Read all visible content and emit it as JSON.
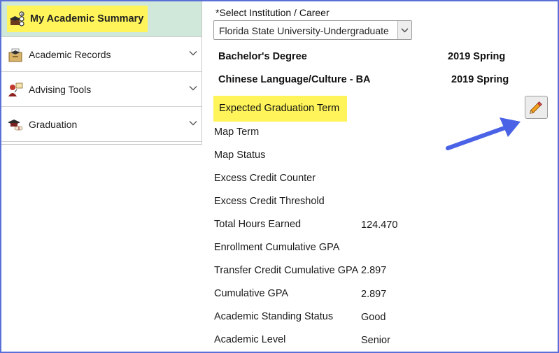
{
  "sidebar": {
    "items": [
      {
        "label": "My Academic Summary",
        "icon": "academic-summary-icon",
        "active": true,
        "expandable": false
      },
      {
        "label": "Academic Records",
        "icon": "academic-records-icon",
        "active": false,
        "expandable": true
      },
      {
        "label": "Advising Tools",
        "icon": "advising-tools-icon",
        "active": false,
        "expandable": true
      },
      {
        "label": "Graduation",
        "icon": "graduation-icon",
        "active": false,
        "expandable": true
      }
    ]
  },
  "main": {
    "select_label": "*Select Institution / Career",
    "select_value": "Florida State University-Undergraduate",
    "degrees": [
      {
        "name": "Bachelor's Degree",
        "term": "2019 Spring"
      },
      {
        "name": "Chinese Language/Culture - BA",
        "term": "2019 Spring"
      }
    ],
    "expected_graduation_label": "Expected Graduation Term",
    "rows": [
      {
        "label": "Map Term",
        "value": ""
      },
      {
        "label": "Map Status",
        "value": ""
      },
      {
        "label": "Excess Credit Counter",
        "value": ""
      },
      {
        "label": "Excess Credit Threshold",
        "value": ""
      },
      {
        "label": "Total Hours Earned",
        "value": "124.470"
      },
      {
        "label": "Enrollment Cumulative GPA",
        "value": ""
      },
      {
        "label": "Transfer Credit Cumulative GPA",
        "value": "2.897"
      },
      {
        "label": "Cumulative GPA",
        "value": "2.897"
      },
      {
        "label": "Academic Standing Status",
        "value": "Good"
      },
      {
        "label": "Academic Level",
        "value": "Senior"
      }
    ]
  },
  "colors": {
    "highlight": "#fff55a",
    "active_nav_bg": "#cfe8d9",
    "frame_border": "#5b6fd8",
    "arrow": "#4a63e6"
  }
}
